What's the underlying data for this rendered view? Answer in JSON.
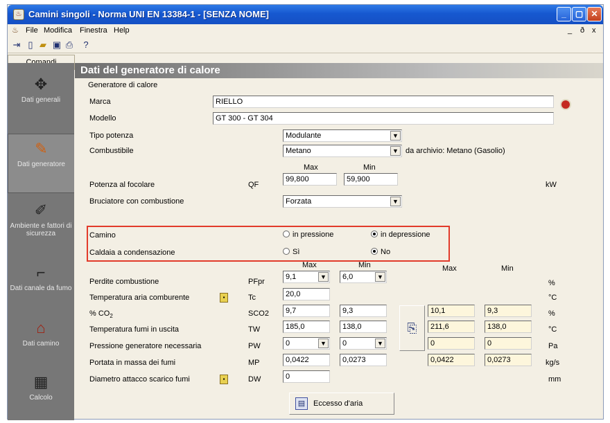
{
  "window": {
    "title": "Camini singoli - Norma UNI EN 13384-1 - [SENZA NOME]",
    "icons": {
      "app": "chimney-app-icon",
      "minimize": "minimize-icon",
      "maximize": "maximize-icon",
      "close": "close-icon"
    }
  },
  "menu": {
    "items": [
      "File",
      "Modifica",
      "Finestra",
      "Help"
    ],
    "mdi_controls": [
      "_",
      "ð",
      "x"
    ]
  },
  "toolbar": {
    "icons": [
      "exit-icon",
      "new-document-icon",
      "open-folder-icon",
      "save-icon",
      "print-icon",
      "help-icon"
    ]
  },
  "sidebar": {
    "tab": "Comandi",
    "items": [
      {
        "label": "Dati generali",
        "icon": "general-data-icon"
      },
      {
        "label": "Dati generatore",
        "icon": "generator-data-icon",
        "selected": true
      },
      {
        "label": "Ambiente e fattori di sicurezza",
        "icon": "environment-icon"
      },
      {
        "label": "Dati canale da fumo",
        "icon": "smoke-duct-icon"
      },
      {
        "label": "Dati camino",
        "icon": "chimney-icon"
      },
      {
        "label": "Calcolo",
        "icon": "calculator-icon"
      }
    ]
  },
  "header": {
    "title": "Dati del generatore di calore"
  },
  "form": {
    "group_label": "Generatore di calore",
    "marca": {
      "label": "Marca",
      "value": "RIELLO"
    },
    "modello": {
      "label": "Modello",
      "value": "GT 300 - GT 304"
    },
    "tipo_potenza": {
      "label": "Tipo potenza",
      "value": "Modulante"
    },
    "combustibile": {
      "label": "Combustibile",
      "value": "Metano",
      "archive_note": "da archivio: Metano (Gasolio)"
    },
    "potenza": {
      "label": "Potenza al focolare",
      "symbol": "QF",
      "max_label": "Max",
      "min_label": "Min",
      "max": "99,800",
      "min": "59,900",
      "unit": "kW"
    },
    "bruciatore": {
      "label": "Bruciatore con combustione",
      "value": "Forzata"
    },
    "camino": {
      "label": "Camino",
      "option_a": "in pressione",
      "option_b": "in depressione",
      "selected": "in depressione"
    },
    "condensazione": {
      "label": "Caldaia a condensazione",
      "option_a": "Sì",
      "option_b": "No",
      "selected": "No"
    },
    "col_headers": {
      "max": "Max",
      "min": "Min",
      "res_max": "Max",
      "res_min": "Min"
    },
    "rows": [
      {
        "label": "Perdite combustione",
        "symbol": "PFpr",
        "max": "9,1",
        "min": "6,0",
        "combo": true,
        "res_max": "",
        "res_min": "",
        "unit": "%"
      },
      {
        "label": "Temperatura aria comburente",
        "symbol": "Tc",
        "max": "20,0",
        "lock": true,
        "unit": "°C"
      },
      {
        "label": "% CO",
        "label_sub": "2",
        "symbol": "SCO2",
        "max": "9,7",
        "min": "9,3",
        "res_max": "10,1",
        "res_min": "9,3",
        "unit": "%"
      },
      {
        "label": "Temperatura fumi in uscita",
        "symbol": "TW",
        "max": "185,0",
        "min": "138,0",
        "res_max": "211,6",
        "res_min": "138,0",
        "unit": "°C"
      },
      {
        "label": "Pressione generatore necessaria",
        "symbol": "PW",
        "max": "0",
        "min": "0",
        "combo": true,
        "res_max": "0",
        "res_min": "0",
        "unit": "Pa"
      },
      {
        "label": "Portata in massa dei fumi",
        "symbol": "MP",
        "max": "0,0422",
        "min": "0,0273",
        "res_max": "0,0422",
        "res_min": "0,0273",
        "unit": "kg/s"
      },
      {
        "label": "Diametro attacco scarico fumi",
        "symbol": "DW",
        "max": "0",
        "lock": true,
        "unit": "mm"
      }
    ],
    "eccesso_button": "Eccesso d'aria",
    "paste_icon": "clipboard-paste-icon",
    "lookup_icon": "database-lookup-icon",
    "lock_icon": "lock-icon"
  }
}
